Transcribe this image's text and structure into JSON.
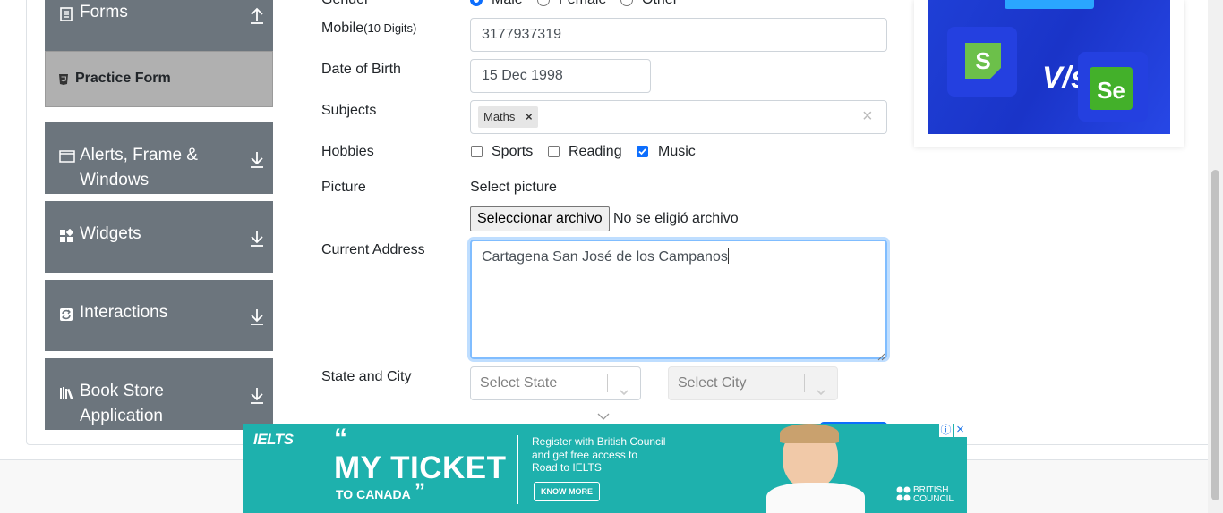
{
  "sidebar": {
    "groups": [
      {
        "label": "Forms"
      },
      {
        "label": "Alerts, Frame &",
        "label2": "Windows"
      },
      {
        "label": "Widgets"
      },
      {
        "label": "Interactions"
      },
      {
        "label": "Book Store",
        "label2": "Application"
      }
    ],
    "active_item": "Practice Form"
  },
  "form": {
    "gender": {
      "label": "Gender",
      "options": [
        "Male",
        "Female",
        "Other"
      ],
      "selected": "Male"
    },
    "mobile": {
      "label": "Mobile",
      "hint": "(10 Digits)",
      "value": "3177937319"
    },
    "dob": {
      "label": "Date of Birth",
      "value": "15 Dec 1998"
    },
    "subjects": {
      "label": "Subjects",
      "chips": [
        "Maths"
      ],
      "chip_remove": "×",
      "clear": "×"
    },
    "hobbies": {
      "label": "Hobbies",
      "options": [
        {
          "label": "Sports",
          "checked": false
        },
        {
          "label": "Reading",
          "checked": false
        },
        {
          "label": "Music",
          "checked": true
        }
      ]
    },
    "picture": {
      "label": "Picture",
      "caption": "Select picture",
      "button": "Seleccionar archivo",
      "status": "No se eligió archivo"
    },
    "address": {
      "label": "Current Address",
      "value": "Cartagena San José de los Campanos"
    },
    "state_city": {
      "label": "State and City",
      "state_placeholder": "Select State",
      "city_placeholder": "Select City"
    }
  },
  "ad_bottom": {
    "brand": "IELTS",
    "headline": "MY TICKET",
    "subline": "TO CANADA",
    "open_quote": "“",
    "close_quote": "”",
    "body_line1": "Register with British Council",
    "body_line2": "and get free access to",
    "body_line3": "Road to IELTS",
    "cta": "KNOW MORE",
    "sponsor_line1": "BRITISH",
    "sponsor_line2": "COUNCIL",
    "info": "ⓘ",
    "close": "×"
  },
  "ad_right": {
    "vs_text": "V/s",
    "left_logo": "S",
    "right_logo": "Se"
  },
  "colors": {
    "sidebar": "#6c757d",
    "accent": "#0d6efd",
    "ad_teal": "#1eb1ad",
    "ad_blue": "#1f3fd6"
  }
}
